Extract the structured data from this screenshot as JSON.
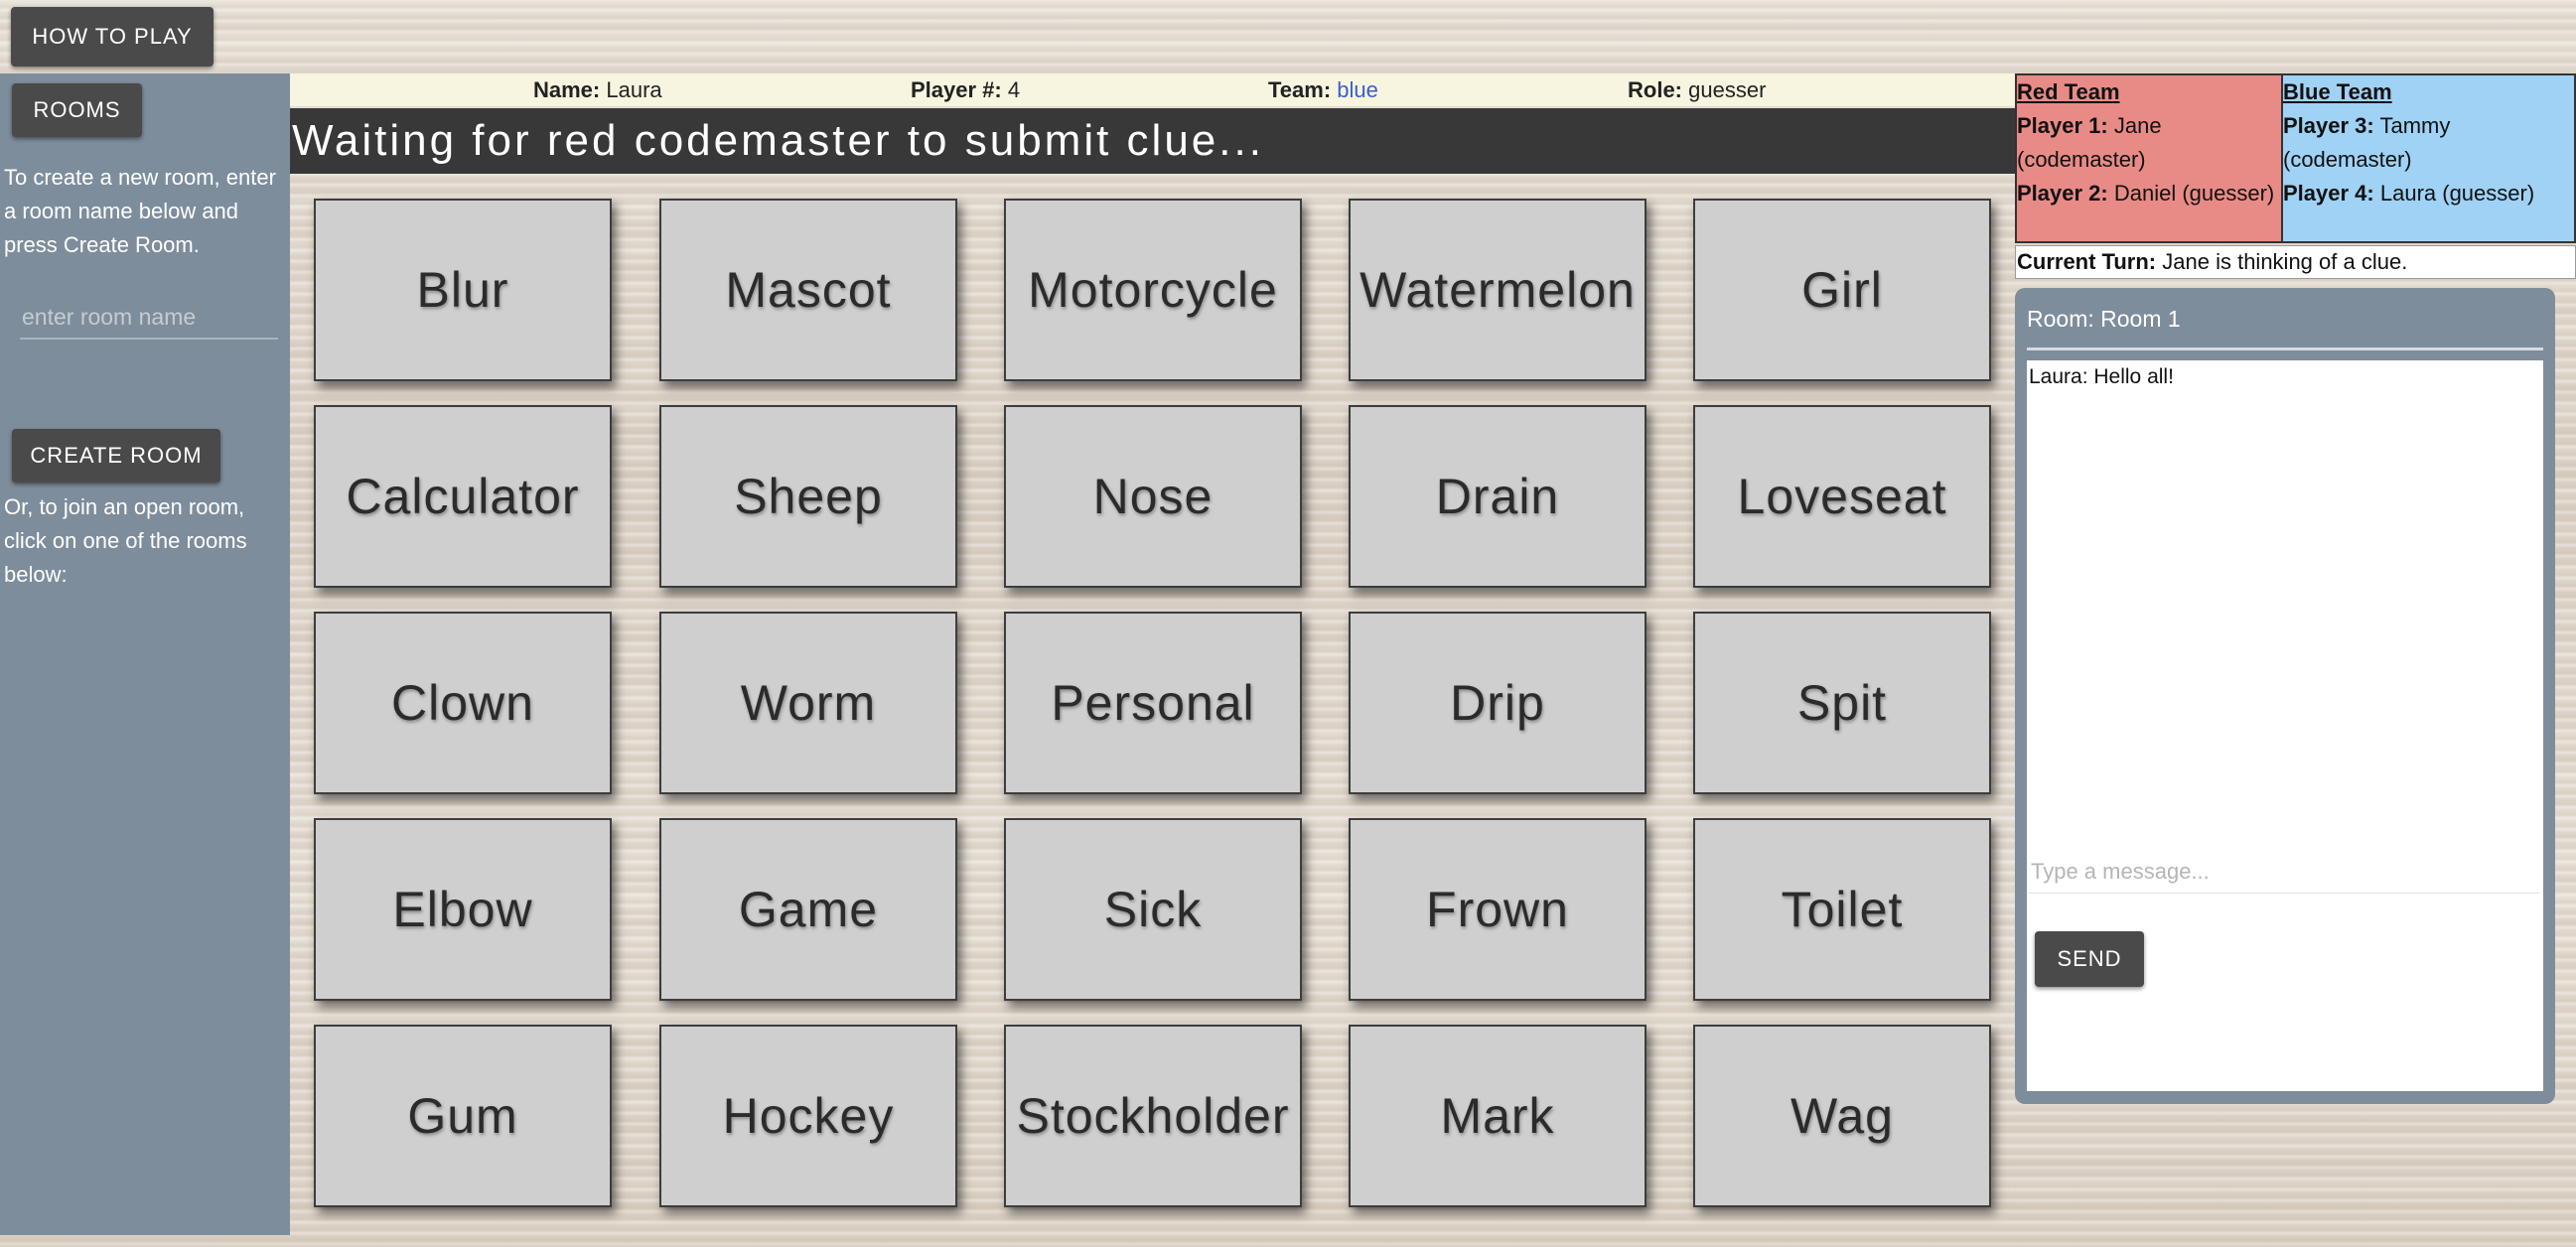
{
  "header": {
    "how_to_play": "HOW TO PLAY"
  },
  "sidebar": {
    "rooms_button": "ROOMS",
    "create_text": "To create a new room, enter a room name below and press Create Room.",
    "room_input_placeholder": "enter room name",
    "create_room_button": "CREATE ROOM",
    "join_text": "Or, to join an open room, click on one of the rooms below:"
  },
  "info": {
    "name_label": "Name:",
    "name_value": "Laura",
    "player_label": "Player #:",
    "player_value": "4",
    "team_label": "Team:",
    "team_value": "blue",
    "role_label": "Role:",
    "role_value": "guesser"
  },
  "status": "Waiting for red codemaster to submit clue...",
  "board": {
    "cards": [
      "Blur",
      "Mascot",
      "Motorcycle",
      "Watermelon",
      "Girl",
      "Calculator",
      "Sheep",
      "Nose",
      "Drain",
      "Loveseat",
      "Clown",
      "Worm",
      "Personal",
      "Drip",
      "Spit",
      "Elbow",
      "Game",
      "Sick",
      "Frown",
      "Toilet",
      "Gum",
      "Hockey",
      "Stockholder",
      "Mark",
      "Wag"
    ],
    "card_color": "#cfcfcf"
  },
  "teams": {
    "red": {
      "title": "Red Team",
      "color": "#e88b87",
      "players": [
        {
          "label": "Player 1:",
          "text": "Jane (codemaster)"
        },
        {
          "label": "Player 2:",
          "text": "Daniel (guesser)"
        }
      ]
    },
    "blue": {
      "title": "Blue Team",
      "color": "#9fd2f5",
      "players": [
        {
          "label": "Player 3:",
          "text": "Tammy (codemaster)"
        },
        {
          "label": "Player 4:",
          "text": "Laura (guesser)"
        }
      ]
    }
  },
  "turn": {
    "label": "Current Turn:",
    "text": "Jane is thinking of a clue."
  },
  "chat": {
    "room_title": "Room: Room 1",
    "messages": [
      "Laura: Hello all!"
    ],
    "input_placeholder": "Type a message...",
    "send_button": "SEND"
  }
}
